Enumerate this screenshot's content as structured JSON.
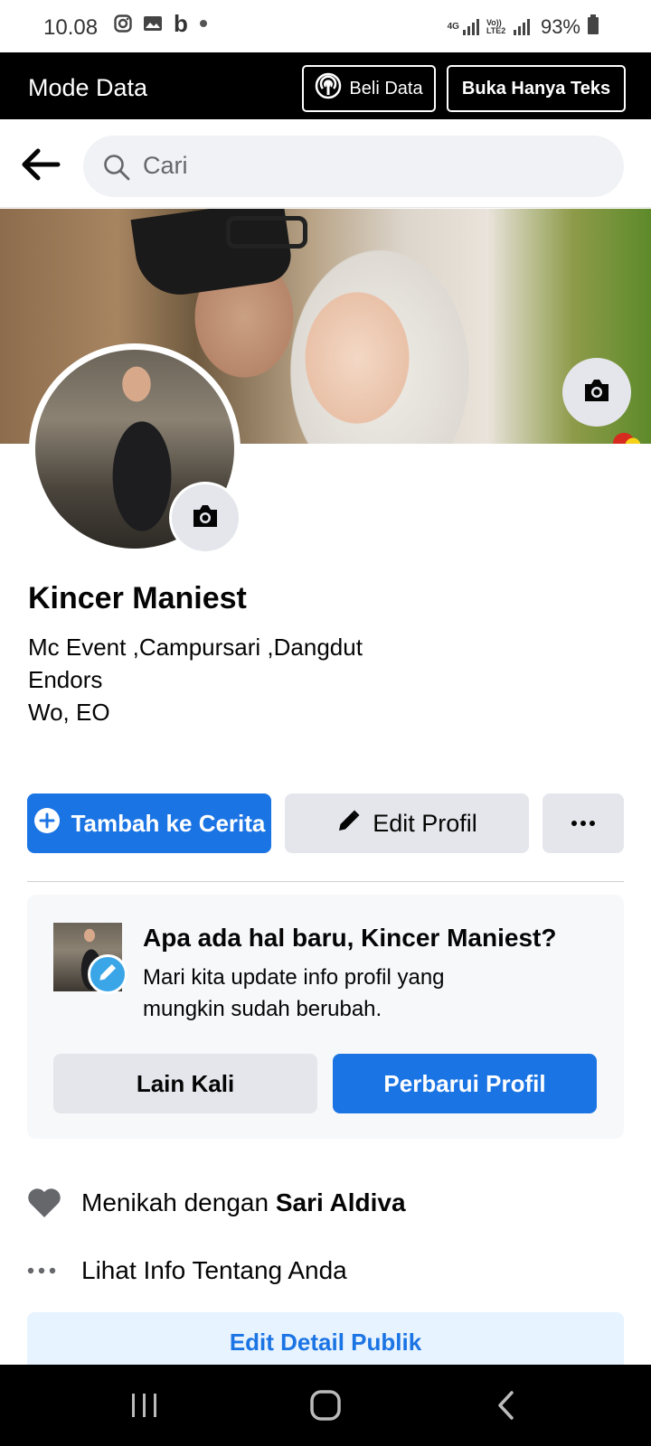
{
  "status_bar": {
    "time": "10.08",
    "signal_label_1": "4G",
    "signal_label_2": "Vo)) LTE2",
    "battery": "93%"
  },
  "mode_bar": {
    "title": "Mode Data",
    "beli_data_label": "Beli Data",
    "text_only_label": "Buka Hanya Teks"
  },
  "search": {
    "placeholder": "Cari"
  },
  "profile": {
    "name": "Kincer Maniest",
    "bio_lines": [
      "Mc Event ,Campursari ,Dangdut",
      "Endors",
      "Wo, EO"
    ]
  },
  "actions": {
    "add_story_label": "Tambah ke Cerita",
    "edit_profile_label": "Edit Profil"
  },
  "update_card": {
    "title": "Apa ada hal baru, Kincer Maniest?",
    "description": "Mari kita update info profil yang mungkin sudah berubah.",
    "later_label": "Lain Kali",
    "update_label": "Perbarui Profil"
  },
  "info": {
    "married_prefix": "Menikah dengan ",
    "married_name": "Sari Aldiva",
    "see_about_label": "Lihat Info Tentang Anda"
  },
  "public_details_label": "Edit Detail Publik",
  "colors": {
    "accent_blue": "#1b74e4",
    "light_blue": "#e7f3ff",
    "button_gray": "#e4e6eb",
    "search_bg": "#f0f2f5",
    "badge_blue": "#3aa6e8"
  },
  "icons": [
    "instagram-icon",
    "gallery-icon",
    "b-app-icon",
    "dot-icon",
    "signal-icon",
    "battery-icon",
    "broadcast-icon",
    "back-arrow-icon",
    "search-icon",
    "camera-icon",
    "plus-circle-icon",
    "pencil-icon",
    "more-dots-icon",
    "heart-icon",
    "recents-icon",
    "home-icon",
    "back-nav-icon"
  ]
}
